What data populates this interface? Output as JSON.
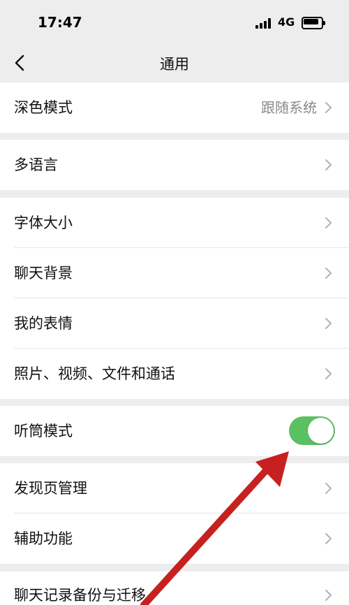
{
  "status_bar": {
    "time": "17:47",
    "network": "4G",
    "signal_icon": "signal-icon",
    "battery_icon": "battery-icon"
  },
  "nav": {
    "title": "通用",
    "back_icon": "chevron-left-icon"
  },
  "groups": {
    "dark_mode": {
      "label": "深色模式",
      "value": "跟随系统"
    },
    "language": {
      "label": "多语言"
    },
    "display": {
      "font_size": "字体大小",
      "chat_background": "聊天背景",
      "my_stickers": "我的表情",
      "media_files_calls": "照片、视频、文件和通话"
    },
    "earpiece": {
      "label": "听筒模式",
      "enabled": true,
      "accent": "#5ac061"
    },
    "discover": {
      "discover_page_management": "发现页管理",
      "accessibility": "辅助功能"
    },
    "backup": {
      "label": "聊天记录备份与迁移"
    }
  },
  "colors": {
    "background": "#ededed",
    "card": "#ffffff",
    "chevron": "#b2b2b2",
    "value_text": "#8a8a8a",
    "toggle_on": "#5ac061",
    "annotation_arrow": "#c62020"
  },
  "annotation": {
    "arrow_icon": "red-arrow-icon"
  }
}
